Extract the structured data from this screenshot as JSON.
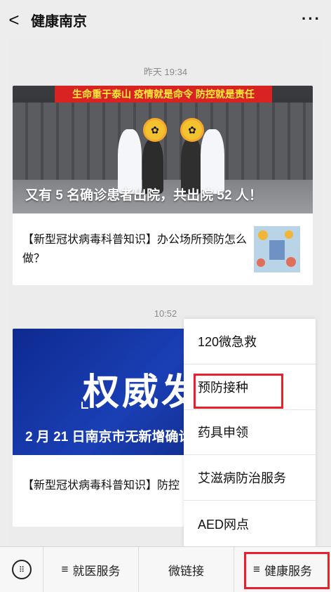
{
  "header": {
    "title": "健康南京",
    "back_glyph": "<",
    "more_glyph": "···"
  },
  "feed": {
    "posts": [
      {
        "time": "昨天 19:34",
        "banner_text": "生命重于泰山 疫情就是命令 防控就是责任",
        "headline": "又有 5 名确诊患者出院，共出院 52 人！",
        "sub_article": "【新型冠状病毒科普知识】办公场所预防怎么做？"
      },
      {
        "time": "10:52",
        "cover_text": "权威发",
        "headline": "2 月 21 日南京市无新增确诊",
        "sub_article": "【新型冠状病毒科普知识】防控"
      }
    ]
  },
  "popup_menu": {
    "items": [
      {
        "label": "120微急救"
      },
      {
        "label": "预防接种"
      },
      {
        "label": "药具申领"
      },
      {
        "label": "艾滋病防治服务"
      },
      {
        "label": "AED网点"
      }
    ],
    "highlight_color": "#e8202c"
  },
  "bottom_menu": {
    "keyboard_icon": "keyboard-icon",
    "items": [
      {
        "prefix": "≡",
        "label": "就医服务"
      },
      {
        "prefix": "",
        "label": "微链接"
      },
      {
        "prefix": "≡",
        "label": "健康服务"
      }
    ]
  }
}
